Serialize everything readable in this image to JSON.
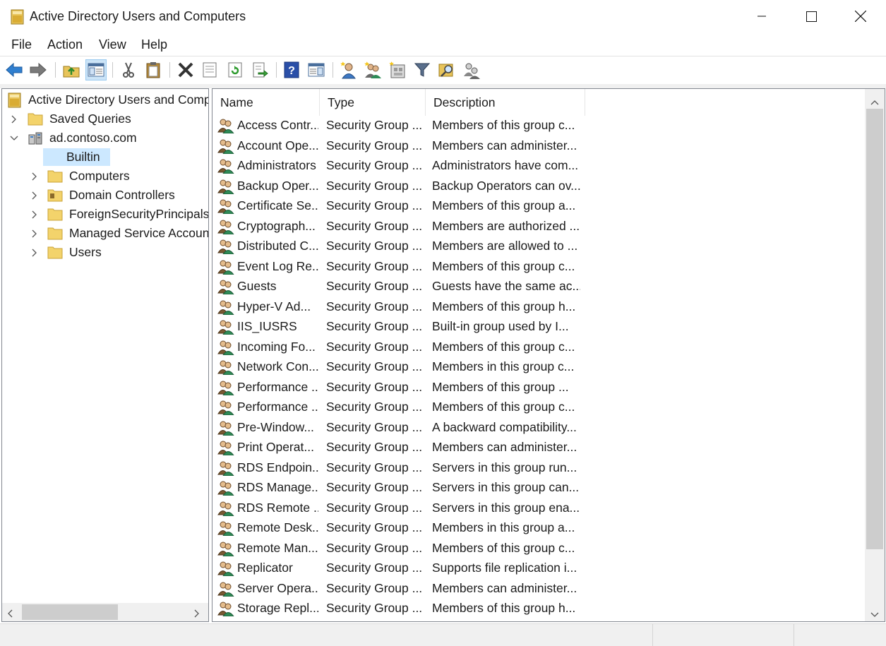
{
  "window": {
    "title": "Active Directory Users and Computers"
  },
  "menu": [
    "File",
    "Action",
    "View",
    "Help"
  ],
  "toolbar": {
    "buttons": [
      "back-icon",
      "forward-icon",
      "up-folder-icon",
      "show-console-tree-icon",
      "cut-icon",
      "paste-icon",
      "delete-icon",
      "properties-icon",
      "refresh-icon",
      "export-list-icon",
      "help-icon",
      "action-pane-icon",
      "new-user-icon",
      "new-group-icon",
      "new-ou-icon",
      "filter-icon",
      "find-icon",
      "add-to-group-icon"
    ]
  },
  "tree": {
    "root": "Active Directory Users and Computers",
    "items": [
      {
        "label": "Saved Queries"
      },
      {
        "label": "ad.contoso.com"
      },
      {
        "label": "Builtin"
      },
      {
        "label": "Computers"
      },
      {
        "label": "Domain Controllers"
      },
      {
        "label": "ForeignSecurityPrincipals"
      },
      {
        "label": "Managed Service Accounts"
      },
      {
        "label": "Users"
      }
    ]
  },
  "list": {
    "columns": [
      "Name",
      "Type",
      "Description"
    ],
    "rows": [
      {
        "name": "Access Contr...",
        "type": "Security Group ...",
        "desc": "Members of this group c..."
      },
      {
        "name": "Account Ope...",
        "type": "Security Group ...",
        "desc": "Members can administer..."
      },
      {
        "name": "Administrators",
        "type": "Security Group ...",
        "desc": "Administrators have com..."
      },
      {
        "name": "Backup Oper...",
        "type": "Security Group ...",
        "desc": "Backup Operators can ov..."
      },
      {
        "name": "Certificate Se...",
        "type": "Security Group ...",
        "desc": "Members of this group a..."
      },
      {
        "name": "Cryptograph...",
        "type": "Security Group ...",
        "desc": "Members are authorized ..."
      },
      {
        "name": "Distributed C...",
        "type": "Security Group ...",
        "desc": "Members are allowed to ..."
      },
      {
        "name": "Event Log Re...",
        "type": "Security Group ...",
        "desc": "Members of this group c..."
      },
      {
        "name": "Guests",
        "type": "Security Group ...",
        "desc": "Guests have the same ac..."
      },
      {
        "name": "Hyper-V Ad...",
        "type": "Security Group ...",
        "desc": "Members of this group h..."
      },
      {
        "name": "IIS_IUSRS",
        "type": "Security Group ...",
        "desc": "Built-in group used by I..."
      },
      {
        "name": "Incoming Fo...",
        "type": "Security Group ...",
        "desc": "Members of this group c..."
      },
      {
        "name": "Network Con...",
        "type": "Security Group ...",
        "desc": "Members in this group c..."
      },
      {
        "name": "Performance ...",
        "type": "Security Group ...",
        "desc": "Members of this group ..."
      },
      {
        "name": "Performance ...",
        "type": "Security Group ...",
        "desc": "Members of this group c..."
      },
      {
        "name": "Pre-Window...",
        "type": "Security Group ...",
        "desc": "A backward compatibility..."
      },
      {
        "name": "Print Operat...",
        "type": "Security Group ...",
        "desc": "Members can administer..."
      },
      {
        "name": "RDS Endpoin...",
        "type": "Security Group ...",
        "desc": "Servers in this group run..."
      },
      {
        "name": "RDS Manage...",
        "type": "Security Group ...",
        "desc": "Servers in this group can..."
      },
      {
        "name": "RDS Remote ...",
        "type": "Security Group ...",
        "desc": "Servers in this group ena..."
      },
      {
        "name": "Remote Desk...",
        "type": "Security Group ...",
        "desc": "Members in this group a..."
      },
      {
        "name": "Remote Man...",
        "type": "Security Group ...",
        "desc": "Members of this group c..."
      },
      {
        "name": "Replicator",
        "type": "Security Group ...",
        "desc": "Supports file replication i..."
      },
      {
        "name": "Server Opera...",
        "type": "Security Group ...",
        "desc": "Members can administer..."
      },
      {
        "name": "Storage Repl...",
        "type": "Security Group ...",
        "desc": "Members of this group h..."
      }
    ]
  },
  "colors": {
    "selection": "#cce8ff",
    "folder": "#f3d36b",
    "accent": "#3c7fc8"
  }
}
